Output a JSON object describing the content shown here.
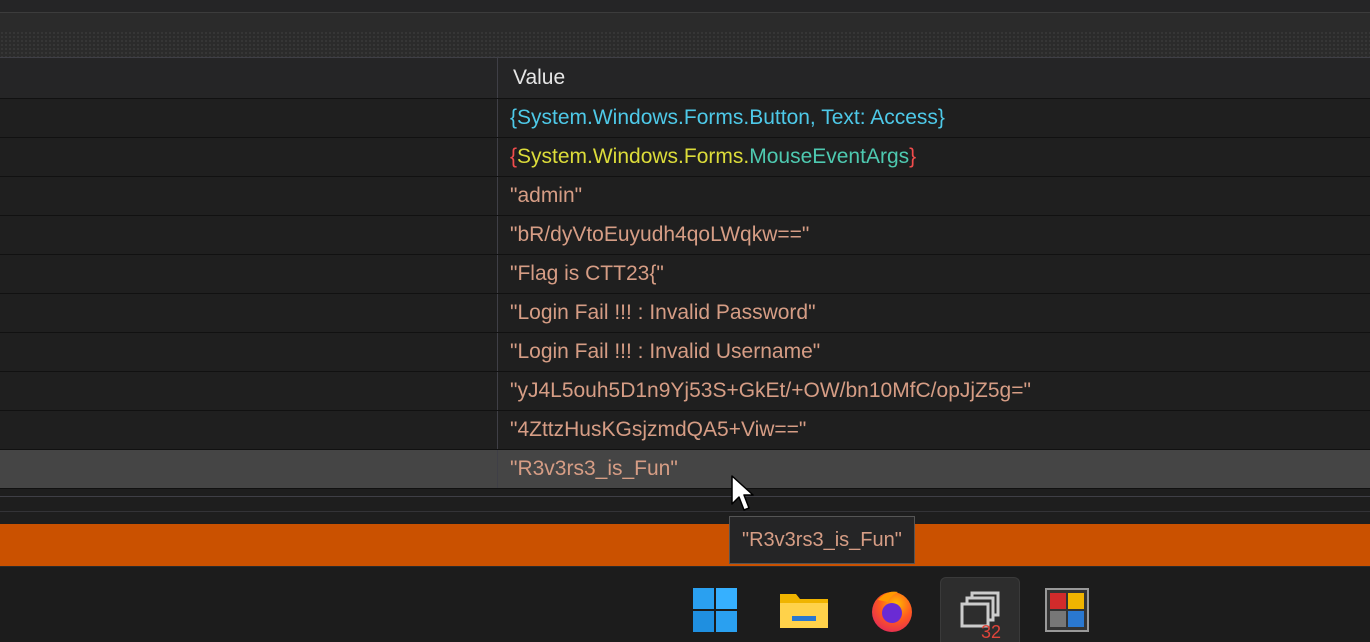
{
  "table": {
    "header": {
      "value_column": "Value"
    },
    "rows": [
      {
        "value_parts": [
          {
            "text": "{System.Windows.Forms.Button, Text: Access}",
            "color": "#4ec9e8"
          }
        ]
      },
      {
        "value_parts": [
          {
            "text": "{",
            "color": "#f14c4c"
          },
          {
            "text": "System.Windows.Forms.",
            "color": "#dcdc3a"
          },
          {
            "text": "MouseEventArgs",
            "color": "#4ec9b0"
          },
          {
            "text": "}",
            "color": "#f14c4c"
          }
        ]
      },
      {
        "value": "\"admin\""
      },
      {
        "value": "\"bR/dyVtoEuyudh4qoLWqkw==\""
      },
      {
        "value": "\"Flag is CTT23{\""
      },
      {
        "value": "\"Login Fail !!! : Invalid Password\""
      },
      {
        "value": "\"Login Fail !!! : Invalid Username\""
      },
      {
        "value": "\"yJ4L5ouh5D1n9Yj53S+GkEt/+OW/bn10MfC/opJjZ5g=\""
      },
      {
        "value": "\"4ZttzHusKGsjzmdQA5+Viw==\""
      },
      {
        "value": "\"R3v3rs3_is_Fun\"",
        "selected": true
      }
    ]
  },
  "tooltip": {
    "text": "\"R3v3rs3_is_Fun\""
  },
  "colors": {
    "status_bar": "#ca5100",
    "string_value": "#d69d85"
  },
  "taskbar": {
    "items": [
      {
        "icon": "windows-start-icon"
      },
      {
        "icon": "file-explorer-icon"
      },
      {
        "icon": "firefox-icon"
      },
      {
        "icon": "task-view-icon",
        "badge": "32",
        "active": true
      },
      {
        "icon": "app-window-icon"
      }
    ]
  }
}
